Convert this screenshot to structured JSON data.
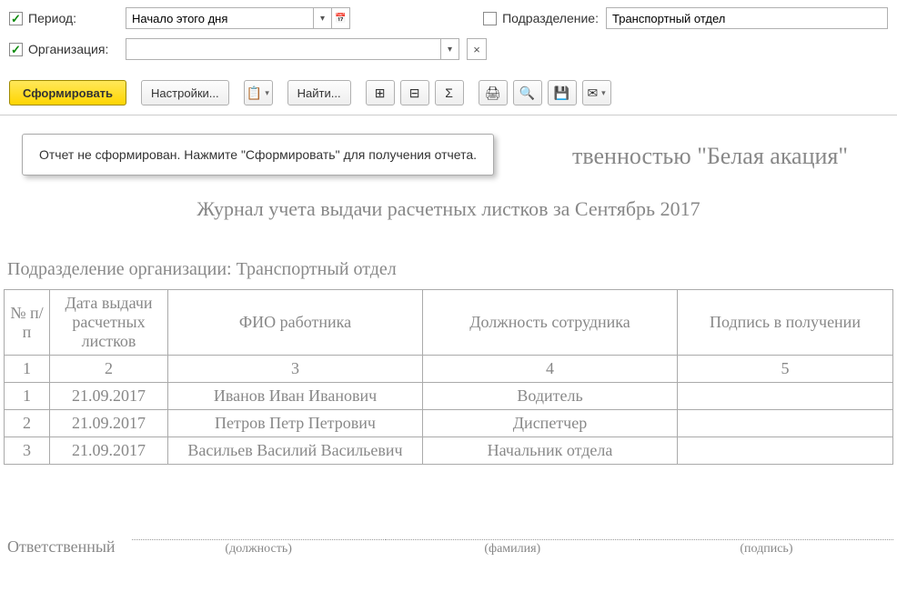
{
  "filters": {
    "period": {
      "label": "Период:",
      "value": "Начало этого дня"
    },
    "organization": {
      "label": "Организация:",
      "value": ""
    },
    "department": {
      "label": "Подразделение:",
      "value": "Транспортный отдел"
    }
  },
  "toolbar": {
    "generate": "Сформировать",
    "settings": "Настройки...",
    "find": "Найти..."
  },
  "hint": "Отчет не сформирован. Нажмите \"Сформировать\" для получения отчета.",
  "report": {
    "title_tail": "твенностью \"Белая акация\"",
    "subtitle": "Журнал учета выдачи расчетных листков за Сентябрь 2017",
    "section": "Подразделение организации: Транспортный отдел",
    "headers": {
      "num": "№ п/п",
      "date": "Дата выдачи расчетных листков",
      "fio": "ФИО работника",
      "pos": "Должность сотрудника",
      "sign": "Подпись в получении"
    },
    "colnums": [
      "1",
      "2",
      "3",
      "4",
      "5"
    ],
    "rows": [
      {
        "n": "1",
        "date": "21.09.2017",
        "fio": "Иванов Иван Иванович",
        "pos": "Водитель"
      },
      {
        "n": "2",
        "date": "21.09.2017",
        "fio": "Петров Петр Петрович",
        "pos": "Диспетчер"
      },
      {
        "n": "3",
        "date": "21.09.2017",
        "fio": "Васильев Василий Васильевич",
        "pos": "Начальник отдела"
      }
    ],
    "responsible": {
      "label": "Ответственный",
      "sub1": "(должность)",
      "sub2": "(фамилия)",
      "sub3": "(подпись)"
    }
  }
}
